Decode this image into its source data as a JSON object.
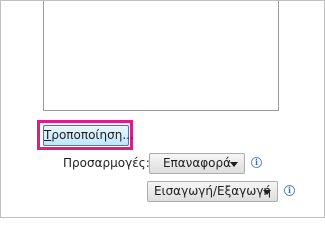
{
  "buttons": {
    "modify_first_letter": "Τ",
    "modify_rest": "ροποποίηση...",
    "reset_label": "Επαναφορά",
    "import_export_label": "Εισαγωγή/Εξαγωγή"
  },
  "labels": {
    "customizations": "Προσαρμογές:"
  },
  "icons": {
    "info_glyph": "i",
    "info_name": "info-icon",
    "dropdown_name": "chevron-down-icon"
  },
  "colors": {
    "highlight": "#e01a8c",
    "focused_button_border": "#3c7fb1",
    "info_icon": "#3a6fb0"
  }
}
